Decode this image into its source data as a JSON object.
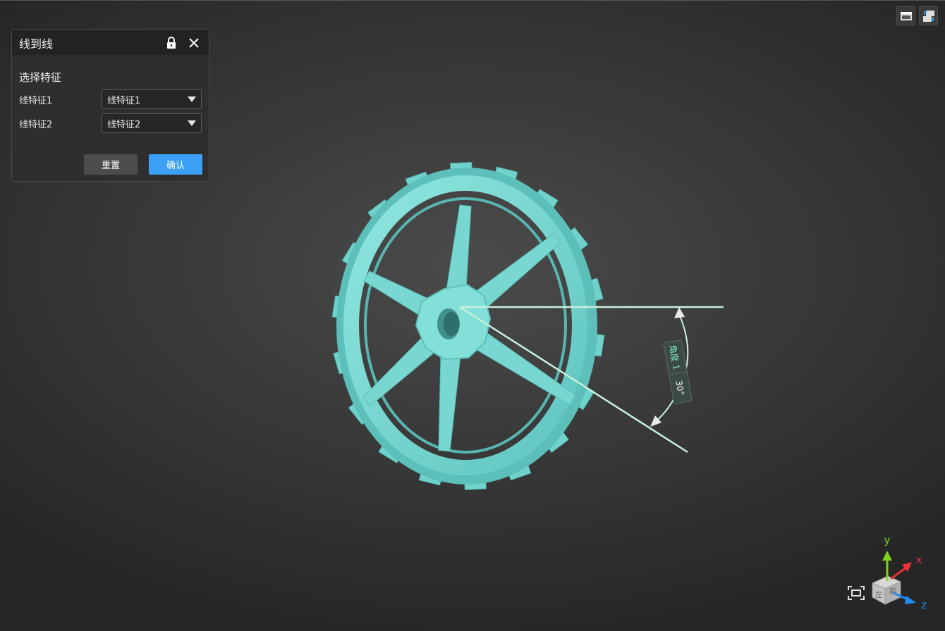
{
  "panel": {
    "title": "线到线",
    "section_title": "选择特征",
    "rows": [
      {
        "label": "线特征1",
        "value": "线特征1"
      },
      {
        "label": "线特征2",
        "value": "线特征2"
      }
    ],
    "reset_label": "重置",
    "confirm_label": "确认",
    "icons": {
      "lock": "lock-icon",
      "close": "close-icon"
    }
  },
  "measurement": {
    "name": "角度 1",
    "value": "30°"
  },
  "axes": {
    "x_label": "x",
    "y_label": "y",
    "z_label": "z",
    "cube_face_left": "左",
    "cube_face_front": "前"
  },
  "colors": {
    "accent": "#3a9ff5",
    "model": "#7fdcd6",
    "measure_line": "#c8f0dc",
    "axis_x": "#e8323c",
    "axis_y": "#7ed321",
    "axis_z": "#1e8cf0"
  }
}
